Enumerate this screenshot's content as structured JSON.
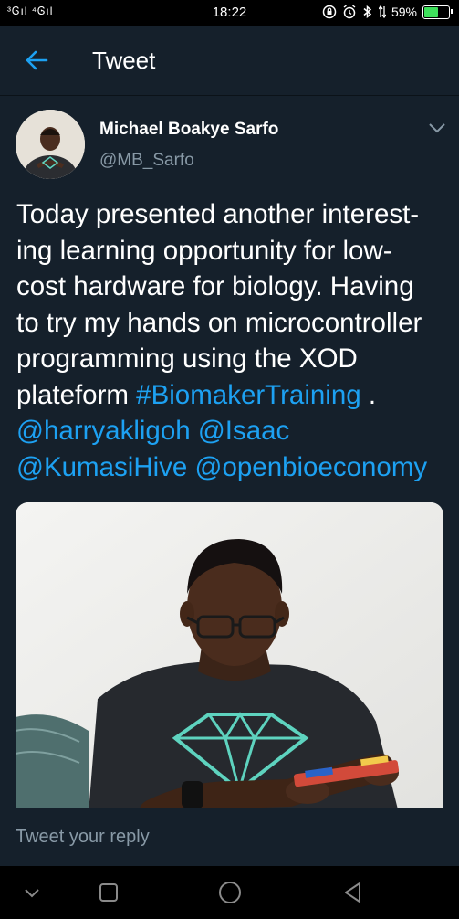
{
  "status_bar": {
    "signal_text": "³Ꮆıl ⁴Ꮆıl",
    "time": "18:22",
    "battery_percent": "59%",
    "battery_level": 0.59
  },
  "header": {
    "title": "Tweet",
    "back_icon": "arrow-left-icon"
  },
  "tweet": {
    "author": {
      "name": "Michael Boakye Sarfo",
      "handle": "@MB_Sarfo"
    },
    "text_lines": [
      "Today presented another interest-",
      "ing learning opportunity for low-",
      "cost hardware for biology. Having",
      "to try my hands on microcontroller",
      "programming using the XOD",
      "plateform ",
      "#BiomakerTraining",
      " .",
      "@harryakligoh @Isaac",
      "@KumasiHive @openbioeconomy"
    ]
  },
  "reply": {
    "placeholder": "Tweet your reply"
  },
  "colors": {
    "background": "#15202b",
    "link": "#1da1f2",
    "secondary_text": "#8899a6",
    "battery_fill": "#3ee05b"
  }
}
